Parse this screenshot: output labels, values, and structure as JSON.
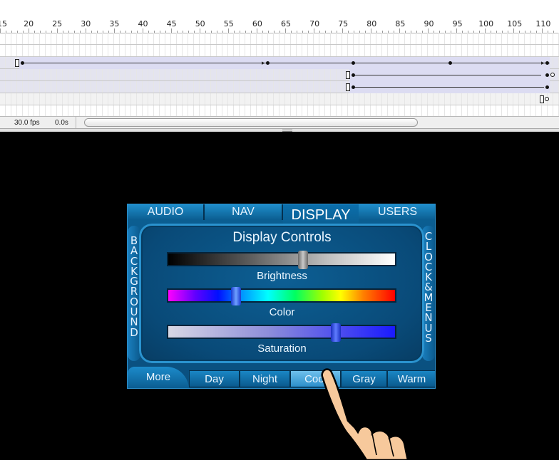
{
  "timeline": {
    "ruler_labels": [
      "15",
      "20",
      "25",
      "30",
      "35",
      "40",
      "45",
      "50",
      "55",
      "60",
      "65",
      "70",
      "75",
      "80",
      "85",
      "90",
      "95",
      "100",
      "105",
      "110"
    ],
    "fps": "30.0 fps",
    "time": "0.0s"
  },
  "device": {
    "top_tabs": [
      "AUDIO",
      "NAV",
      "DISPLAY",
      "USERS"
    ],
    "active_tab": "DISPLAY",
    "left_vertical": [
      "B",
      "A",
      "C",
      "K",
      "G",
      "R",
      "O",
      "U",
      "N",
      "D"
    ],
    "right_vertical": [
      "C",
      "L",
      "O",
      "C",
      "K",
      "&",
      "M",
      "E",
      "N",
      "U",
      "S"
    ],
    "title": "Display Controls",
    "sliders": [
      {
        "label": "Brightness",
        "value": 0.6
      },
      {
        "label": "Color",
        "value": 0.29
      },
      {
        "label": "Saturation",
        "value": 0.75
      }
    ],
    "bottom_tabs": [
      "More",
      "Day",
      "Night",
      "Cool",
      "Gray",
      "Warm"
    ],
    "selected_bottom_tab": "Cool",
    "colors": {
      "panel": "#0b5f93",
      "accent": "#2a93cf",
      "text": "#eaf6ff"
    }
  }
}
